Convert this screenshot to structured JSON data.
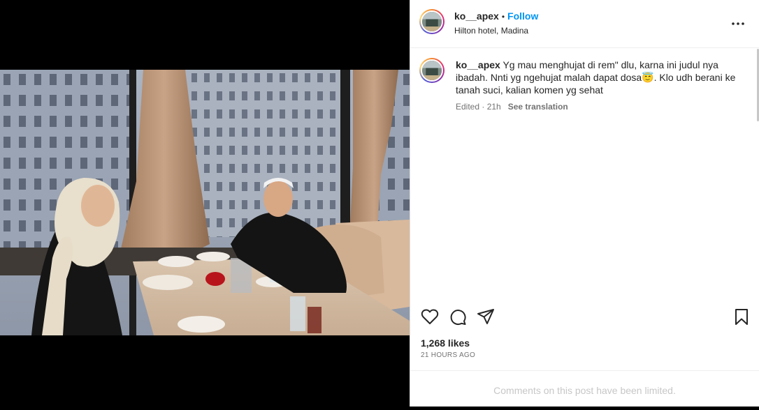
{
  "post": {
    "username": "ko__apex",
    "separator": "•",
    "follow_label": "Follow",
    "location": "Hilton hotel, Madina",
    "more_icon": "more-options-icon"
  },
  "caption": {
    "username": "ko__apex",
    "text": "Yg mau menghujat di rem\" dlu, karna ini judul nya ibadah. Nnti yg ngehujat malah dapat dosa😇. Klo udh berani ke tanah suci, kalian komen yg sehat",
    "edited_label": "Edited",
    "meta_separator": " · ",
    "time": "21h",
    "see_translation": "See translation"
  },
  "actions": {
    "like_icon": "heart-icon",
    "comment_icon": "comment-icon",
    "share_icon": "send-icon",
    "save_icon": "bookmark-icon"
  },
  "stats": {
    "likes": "1,268 likes",
    "time_ago": "21 HOURS AGO"
  },
  "footer": {
    "limited_text": "Comments on this post have been limited."
  },
  "colors": {
    "link_blue": "#0095f6",
    "secondary_text": "#737373",
    "border": "#dbdbdb"
  }
}
